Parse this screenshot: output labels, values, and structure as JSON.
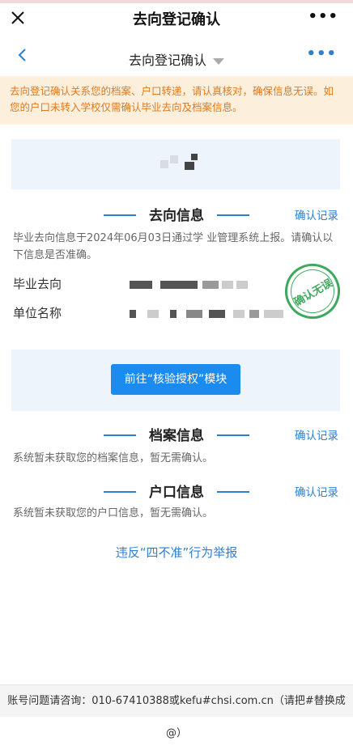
{
  "window": {
    "title": "去向登记确认",
    "more_label": "•••",
    "close_label": "✕"
  },
  "nav": {
    "title": "去向登记确认",
    "more_label": "•••"
  },
  "notice": {
    "text": "去向登记确认关系您的档案、户口转递，请认真核对，确保信息无误。如您的户口未转入学校仅需确认毕业去向及档案信息。"
  },
  "sections": {
    "destination": {
      "title": "去向信息",
      "link": "确认记录",
      "desc": "毕业去向信息于2024年06月03日通过学 业管理系统上报。请确认以下信息是否准确。",
      "fields": [
        {
          "label": "毕业去向"
        },
        {
          "label": "单位名称"
        }
      ],
      "stamp": "确认无误"
    },
    "auth_button": "前往“核验授权”模块",
    "archive": {
      "title": "档案信息",
      "link": "确认记录",
      "desc": "系统暂未获取您的档案信息，暂无需确认。"
    },
    "household": {
      "title": "户口信息",
      "link": "确认记录",
      "desc": "系统暂未获取您的户口信息，暂无需确认。"
    }
  },
  "report_link": "违反“四不准”行为举报",
  "footer": {
    "text": "账号问题请咨询：010-67410388或kefu#chsi.com.cn（请把#替换成@）"
  },
  "colors": {
    "accent": "#2d7fd2",
    "button": "#1b8bef",
    "notice_bg": "#fcefdc",
    "notice_text": "#e07a1f",
    "stamp": "#3fa85f"
  }
}
